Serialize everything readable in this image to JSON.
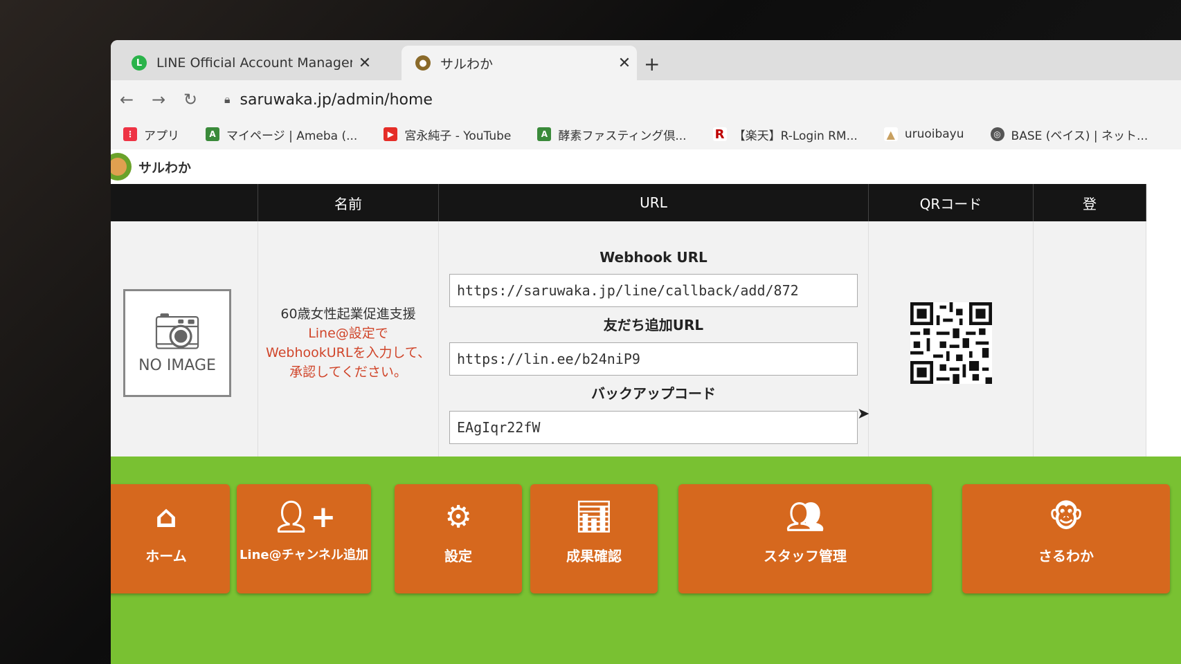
{
  "browser": {
    "tabs": [
      {
        "title": "LINE Official Account Manager",
        "favicon": "line-icon",
        "active": false
      },
      {
        "title": "サルわか",
        "favicon": "saruwaka-icon",
        "active": true
      }
    ],
    "close_glyph": "✕",
    "new_tab_glyph": "+",
    "url": "saruwaka.jp/admin/home",
    "bookmarks": [
      {
        "label": "アプリ",
        "icon": "apps-grid-icon"
      },
      {
        "label": "マイページ | Ameba (...",
        "icon": "ameba-icon"
      },
      {
        "label": "宮永純子 - YouTube",
        "icon": "youtube-icon"
      },
      {
        "label": "酵素ファスティング倶...",
        "icon": "ameba-icon"
      },
      {
        "label": "【楽天】R-Login RM...",
        "icon": "rakuten-icon"
      },
      {
        "label": "uruoibayu",
        "icon": "tent-icon"
      },
      {
        "label": "BASE (ベイス) | ネット...",
        "icon": "globe-icon"
      }
    ]
  },
  "site": {
    "logo_text": "サルわか"
  },
  "table": {
    "headers": {
      "name": "名前",
      "url": "URL",
      "qr": "QRコード",
      "register": "登"
    },
    "row": {
      "image_text": "NO IMAGE",
      "name": "60歳女性起業促進支援",
      "warning": "Line@設定でWebhookURLを入力して、承認してください。",
      "fields": [
        {
          "label": "Webhook URL",
          "value": "https://saruwaka.jp/line/callback/add/872"
        },
        {
          "label": "友だち追加URL",
          "value": "https://lin.ee/b24niP9"
        },
        {
          "label": "バックアップコード",
          "value": "EAgIqr22fW"
        }
      ]
    }
  },
  "actions": [
    {
      "label": "ホーム",
      "icon": "home-icon"
    },
    {
      "label": "Line@チャンネル追加",
      "icon": "add-user-icon"
    },
    {
      "label": "設定",
      "icon": "gear-icon"
    },
    {
      "label": "成果確認",
      "icon": "presentation-icon"
    },
    {
      "label": "スタッフ管理",
      "icon": "staff-icon"
    },
    {
      "label": "さるわか",
      "icon": "monkey-icon"
    }
  ],
  "colors": {
    "header_bg": "#151515",
    "action_bar": "#79c132",
    "action_button": "#d6681e",
    "warning_text": "#d0452a"
  }
}
